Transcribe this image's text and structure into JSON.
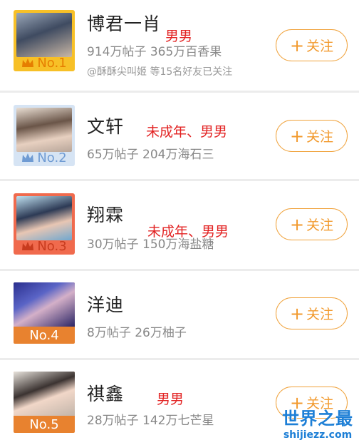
{
  "follow_label": "关注",
  "items": [
    {
      "rank": "No.1",
      "name": "博君一肖",
      "stats": "914万帖子 365万百香果",
      "friends": "@酥酥尖叫姬 等15名好友已关注",
      "note": "男男"
    },
    {
      "rank": "No.2",
      "name": "文轩",
      "stats": "65万帖子 204万海石三",
      "note": "未成年、男男"
    },
    {
      "rank": "No.3",
      "name": "翔霖",
      "stats": "30万帖子 150万海盐糖",
      "note": "未成年、男男"
    },
    {
      "rank": "No.4",
      "name": "洋迪",
      "stats": "8万帖子 26万柚子"
    },
    {
      "rank": "No.5",
      "name": "祺鑫",
      "stats": "28万帖子 142万七芒星",
      "note": "男男"
    }
  ],
  "watermark": {
    "title": "世界之最",
    "url": "shijiezz.com"
  },
  "colors": {
    "accent": "#f29a2e",
    "note": "#e22222",
    "rank1": "#f7c027",
    "rank2": "#8fb4e0",
    "rank3": "#f06a4d",
    "rank_other": "#e8822f"
  }
}
